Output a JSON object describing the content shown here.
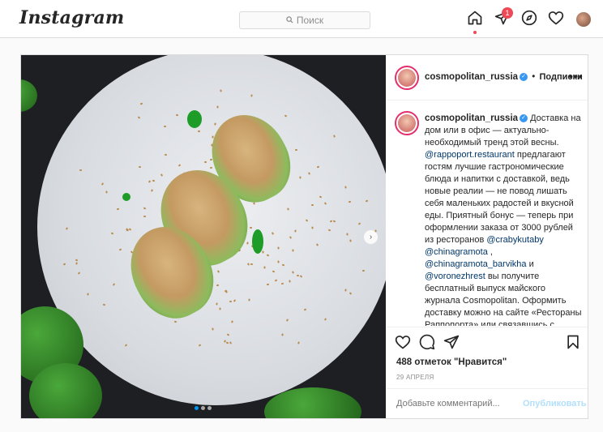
{
  "header": {
    "logo": "Instagram",
    "search_placeholder": "Поиск",
    "notification_count": "1"
  },
  "post": {
    "username": "cosmopolitan_russia",
    "follow_label": "Подписки",
    "follow_separator": "•",
    "more_label": "•••",
    "carousel": {
      "total": 3,
      "active": 0
    },
    "caption": {
      "username": "cosmopolitan_russia",
      "parts": [
        {
          "type": "text",
          "value": " Доставка на дом или в офис — актуально-необходимый тренд этой весны. "
        },
        {
          "type": "mention",
          "value": "@rappoport.restaurant"
        },
        {
          "type": "text",
          "value": " предлагают гостям лучшие гастрономические блюда и напитки с доставкой, ведь новые реалии — не повод лишать себя маленьких радостей и вкусной еды. Приятный бонус — теперь при оформлении заказа от 3000 рублей из ресторанов "
        },
        {
          "type": "mention",
          "value": "@crabykutaby"
        },
        {
          "type": "text",
          "value": " "
        },
        {
          "type": "mention",
          "value": "@chinagramota"
        },
        {
          "type": "text",
          "value": " , "
        },
        {
          "type": "mention",
          "value": "@chinagramota_barvikha"
        },
        {
          "type": "text",
          "value": " и "
        },
        {
          "type": "mention",
          "value": "@voronezhrest"
        },
        {
          "type": "text",
          "value": " вы получите бесплатный выпуск майского журнала Cosmopolitan. Оформить доставку можно на сайте «Рестораны Раппопорта» или связавшись с выбранным рестораном напрямую. Спешите,"
        }
      ]
    },
    "likes": "488 отметок \"Нравится\"",
    "date": "29 АПРЕЛЯ",
    "comment_placeholder": "Добавьте комментарий...",
    "publish_label": "Опубликовать"
  },
  "icons": {
    "home": "home-icon",
    "direct": "direct-icon",
    "explore": "compass-icon",
    "activity": "heart-icon",
    "like": "heart-icon",
    "comment": "comment-icon",
    "share": "share-icon",
    "save": "bookmark-icon"
  },
  "colors": {
    "accent": "#0095f6",
    "notification": "#ed4956",
    "publish_disabled": "#b2dffc"
  }
}
